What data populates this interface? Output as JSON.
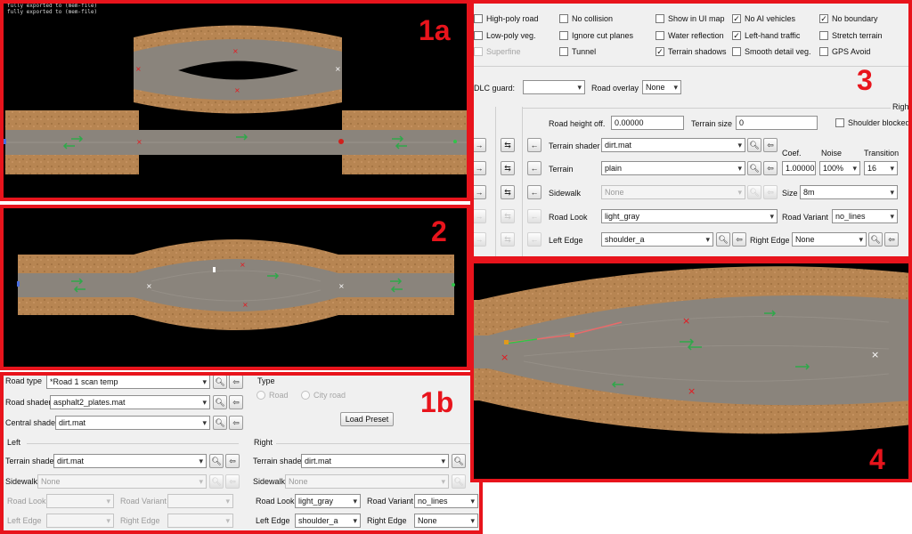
{
  "badges": {
    "p1a": "1a",
    "p2": "2",
    "p1b": "1b",
    "p3": "3",
    "p4": "4"
  },
  "log_lines": [
    "fully exported to (mem-file)",
    "fully exported to (mem-file)"
  ],
  "icons": {
    "search": "magnifier-icon",
    "back": "back-arrow-icon",
    "arrow_left": "arrow-left-icon",
    "arrow_right": "arrow-right-icon",
    "swap": "swap-arrows-icon",
    "check": "✓"
  },
  "colors": {
    "accent_border": "#e8141c",
    "road": "#8a847c",
    "terrain": "#b78552",
    "viewport_bg": "#000000",
    "gui_bg": "#f0f0f0",
    "lane_arrow": "#2fa84a"
  },
  "panel1b": {
    "road_type_label": "Road type",
    "road_type_value": "*Road 1 scan temp",
    "road_shader_label": "Road shader",
    "road_shader_value": "asphalt2_plates.mat",
    "central_shader_label": "Central shader",
    "central_shader_value": "dirt.mat",
    "type_group_label": "Type",
    "radio_road": "Road",
    "radio_city_road": "City road",
    "load_preset": "Load Preset",
    "left": {
      "header": "Left",
      "terrain_shader_label": "Terrain shader",
      "terrain_shader_value": "dirt.mat",
      "sidewalk_label": "Sidewalk",
      "sidewalk_value": "None",
      "road_look_label": "Road Look",
      "road_variant_label": "Road Variant",
      "left_edge_label": "Left Edge",
      "right_edge_label": "Right Edge"
    },
    "right": {
      "header": "Right",
      "terrain_shader_label": "Terrain shader",
      "terrain_shader_value": "dirt.mat",
      "sidewalk_label": "Sidewalk",
      "sidewalk_value": "None",
      "road_look_label": "Road Look",
      "road_look_value": "light_gray",
      "road_variant_label": "Road Variant",
      "road_variant_value": "no_lines",
      "left_edge_label": "Left Edge",
      "left_edge_value": "shoulder_a",
      "right_edge_label": "Right Edge",
      "right_edge_value": "None"
    }
  },
  "panel3": {
    "checkboxes": [
      {
        "label": "High-poly road",
        "checked": false,
        "disabled": false
      },
      {
        "label": "No collision",
        "checked": false,
        "disabled": false
      },
      {
        "label": "Show in UI map",
        "checked": false,
        "disabled": false
      },
      {
        "label": "No AI vehicles",
        "checked": true,
        "disabled": false
      },
      {
        "label": "No boundary",
        "checked": true,
        "disabled": false
      },
      {
        "label": "Low-poly veg.",
        "checked": false,
        "disabled": false
      },
      {
        "label": "Ignore cut planes",
        "checked": false,
        "disabled": false
      },
      {
        "label": "Water reflection",
        "checked": false,
        "disabled": false
      },
      {
        "label": "Left-hand traffic",
        "checked": true,
        "disabled": false
      },
      {
        "label": "Stretch terrain",
        "checked": false,
        "disabled": false
      },
      {
        "label": "Superfine",
        "checked": false,
        "disabled": true
      },
      {
        "label": "Tunnel",
        "checked": false,
        "disabled": false
      },
      {
        "label": "Terrain shadows",
        "checked": true,
        "disabled": false
      },
      {
        "label": "Smooth detail veg.",
        "checked": false,
        "disabled": false
      },
      {
        "label": "GPS Avoid",
        "checked": false,
        "disabled": false
      }
    ],
    "dlc_guard_label": "DLC guard:",
    "dlc_guard_value": "",
    "road_overlay_label": "Road overlay",
    "road_overlay_value": "None",
    "right_header": "Righ",
    "road_height_label": "Road height off.",
    "road_height_value": "0.00000",
    "terrain_size_label": "Terrain size",
    "terrain_size_value": "0",
    "shoulder_blocked_label": "Shoulder blocked",
    "terrain_shader_label": "Terrain shader",
    "terrain_shader_value": "dirt.mat",
    "terrain_label": "Terrain",
    "terrain_value": "plain",
    "coef_label": "Coef.",
    "coef_value": "1.00000",
    "noise_label": "Noise",
    "noise_value": "100%",
    "transition_label": "Transition",
    "transition_value": "16",
    "sidewalk_label": "Sidewalk",
    "sidewalk_value": "None",
    "size_label": "Size",
    "size_value": "8m",
    "road_look_label": "Road Look",
    "road_look_value": "light_gray",
    "road_variant_label": "Road Variant",
    "road_variant_value": "no_lines",
    "left_edge_label": "Left Edge",
    "left_edge_value": "shoulder_a",
    "right_edge_label": "Right Edge",
    "right_edge_value": "None"
  }
}
